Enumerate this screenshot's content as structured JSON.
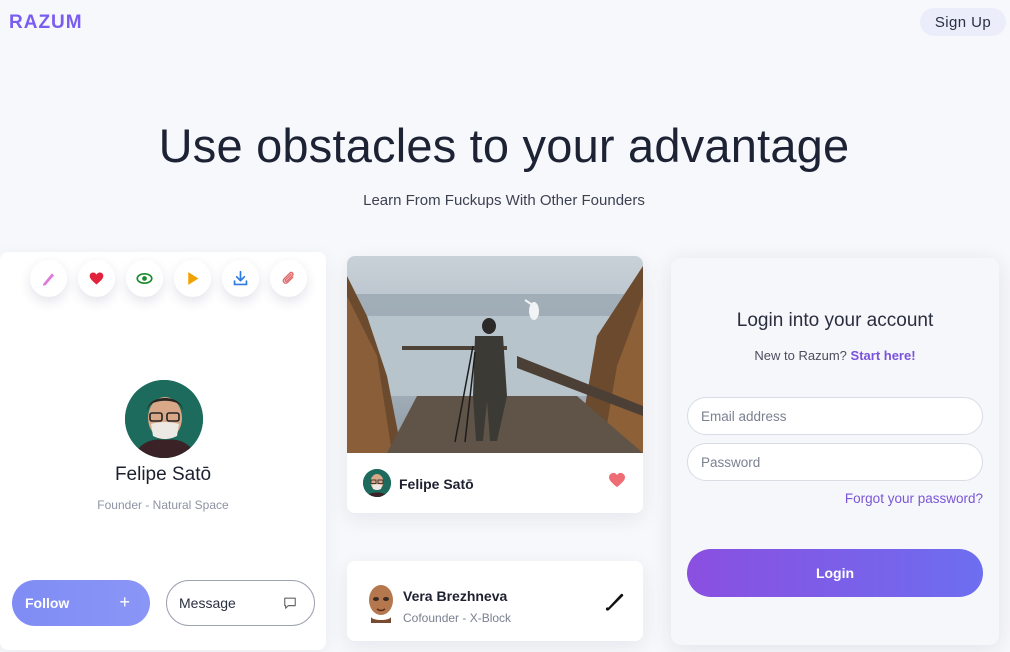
{
  "nav": {
    "brand": "RAZUM",
    "signup_label": "Sign Up"
  },
  "hero": {
    "title": "Use obstacles to your advantage",
    "subtitle": "Learn From Fuckups With Other Founders"
  },
  "profile_card": {
    "icons": [
      "pencil-icon",
      "heart-icon",
      "eye-icon",
      "play-icon",
      "download-icon",
      "paperclip-icon"
    ],
    "name": "Felipe Satō",
    "role": "Founder - Natural Space",
    "follow_label": "Follow",
    "follow_icon": "+",
    "message_label": "Message"
  },
  "photo_card": {
    "author": "Felipe Satō"
  },
  "vera_card": {
    "name": "Vera Brezhneva",
    "role": "Cofounder - X-Block"
  },
  "login": {
    "title": "Login into your account",
    "new_prompt": "New to Razum?",
    "start_link": "Start here!",
    "email_placeholder": "Email address",
    "password_placeholder": "Password",
    "forgot_label": "Forgot your password?",
    "login_label": "Login"
  },
  "colors": {
    "brand": "#7a5cf0",
    "accent": "#7b55d8",
    "heart": "#e0223a",
    "eye": "#1a8a2e",
    "play": "#f2a200",
    "download": "#2f7be0",
    "pencil": "#e07ad8"
  }
}
